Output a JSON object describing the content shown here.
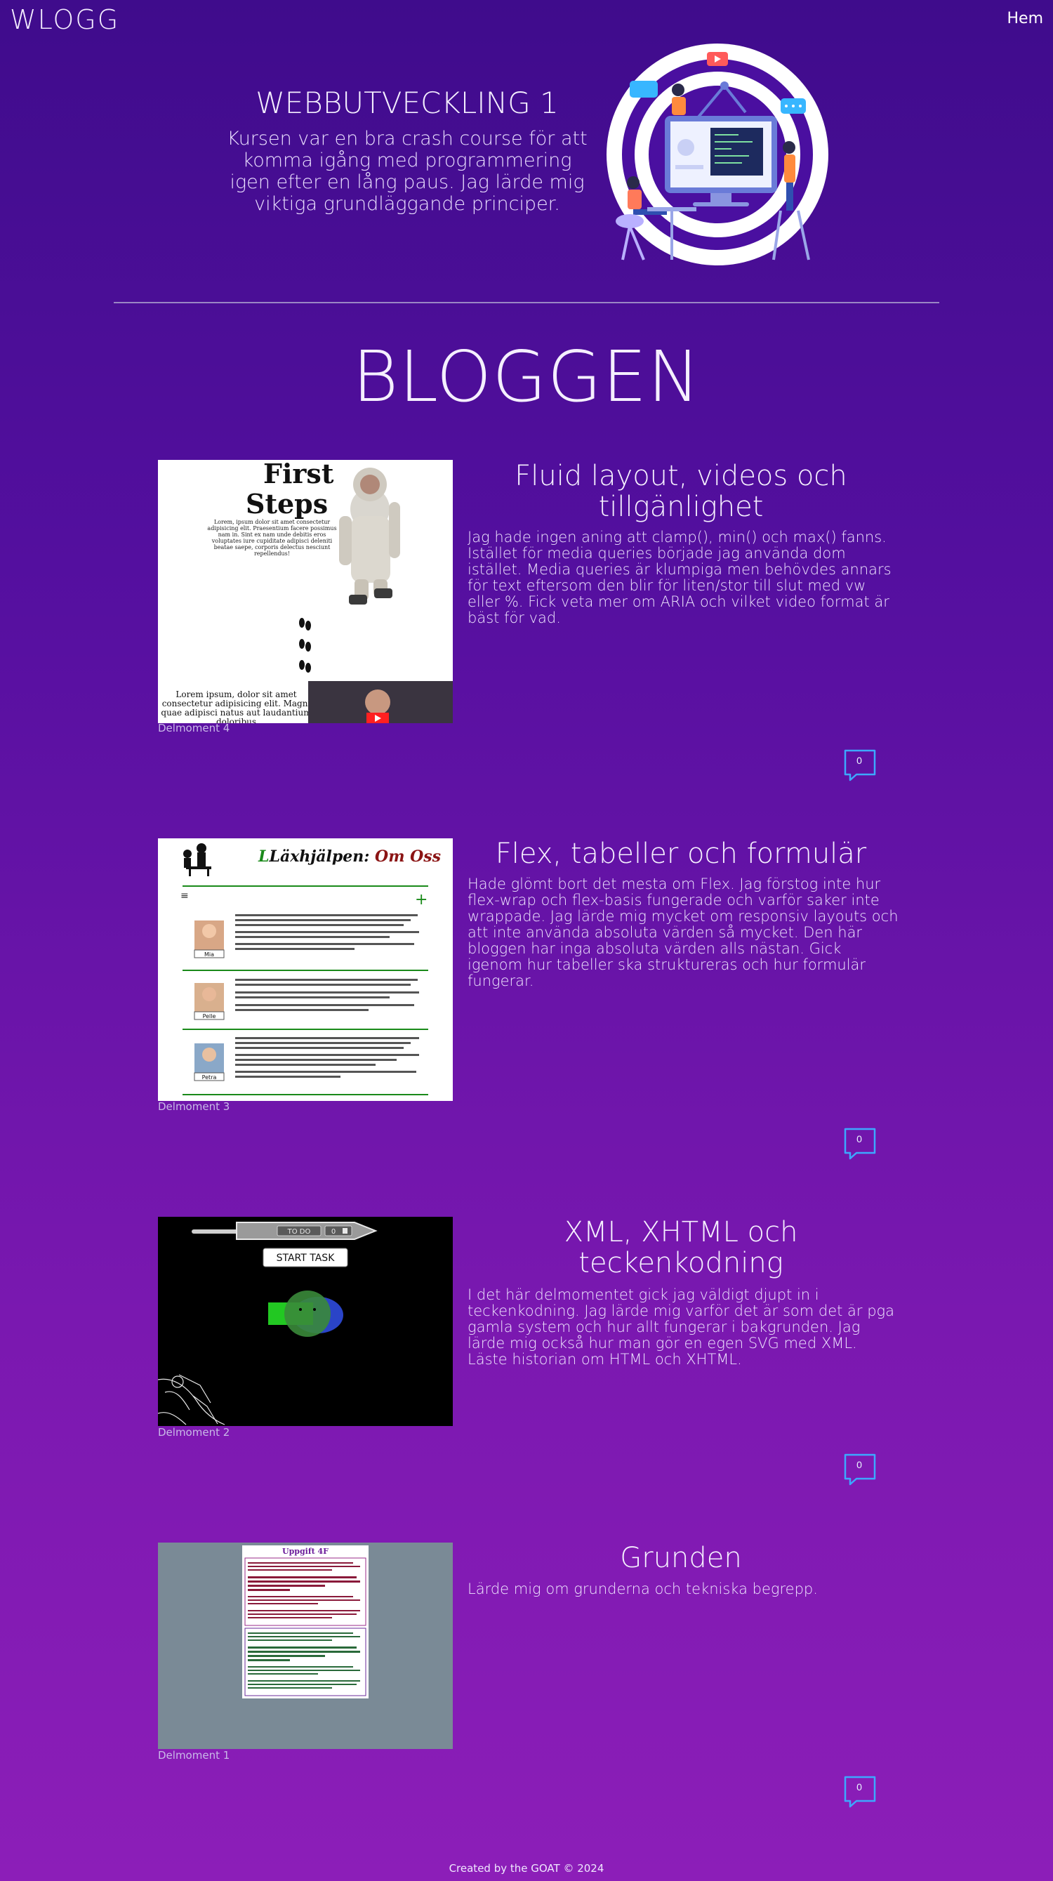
{
  "header": {
    "logo": "WLOGG",
    "nav_home": "Hem"
  },
  "hero": {
    "title": "WEBBUTVECKLING 1",
    "text": "Kursen var en bra crash course för att komma igång med programmering igen efter en lång paus. Jag lärde mig viktiga grundläggande principer."
  },
  "blog": {
    "heading": "BLOGGEN",
    "posts": [
      {
        "title": "Fluid layout, videos och tillgänlighet",
        "text": "Jag hade ingen aning att clamp(), min() och max() fanns. Istället för media queries började jag använda dom istället. Media queries är klumpiga men behövdes annars för text eftersom den blir för liten/stor till slut med vw eller %. Fick veta mer om ARIA och vilket video format är bäst för vad.",
        "caption": "Delmoment 4",
        "comments": "0",
        "thumb": {
          "h1": "First",
          "h2": "Steps",
          "lorem_top": "Lorem, ipsum dolor sit amet consectetur adipisicing elit. Praesentium facere possimus nam in. Sint ex nam unde debitis eros voluptates iure cupiditate adipisci deleniti beatae saepe, corporis delectus nesciunt repellendus!",
          "lorem_bottom": "Lorem ipsum, dolor sit amet consectetur adipisicing elit. Magni quae adipisci natus aut laudantium doloribus"
        }
      },
      {
        "title": "Flex, tabeller och formulär",
        "text": "Hade glömt bort det mesta om Flex. Jag förstog inte hur flex-wrap och flex-basis fungerade och varför saker inte wrappade. Jag lärde mig mycket om responsiv layouts och att inte använda absoluta värden så mycket. Den här bloggen har inga absoluta värden alls nästan. Gick igenom hur tabeller ska struktureras och hur formulär fungerar.",
        "caption": "Delmoment 3",
        "comments": "0",
        "thumb": {
          "title_a": "Läxhjälpen: ",
          "title_b": "Om Oss",
          "names": [
            "Mia",
            "Pelle",
            "Petra"
          ]
        }
      },
      {
        "title": "XML, XHTML och teckenkodning",
        "text": "I det här delmomentet gick jag väldigt djupt in i teckenkodning. Jag lärde mig varför det är som det är pga gamla system och hur allt fungerar i bakgrunden. Jag lärde mig också hur man gör en egen SVG med XML. Läste historian om HTML och XHTML.",
        "caption": "Delmoment 2",
        "comments": "0",
        "thumb": {
          "todo": "TO DO",
          "counter": "0",
          "start": "START TASK"
        }
      },
      {
        "title": "Grunden",
        "text": "Lärde mig om grunderna och tekniska begrepp.",
        "caption": "Delmoment 1",
        "comments": "0",
        "thumb": {
          "title": "Uppgift 4F"
        }
      }
    ]
  },
  "footer": {
    "text": "Created by the GOAT © 2024"
  },
  "colors": {
    "accent": "#3da8ff",
    "bg_top": "#3f0c8c",
    "bg_bottom": "#8c1eb8"
  },
  "icons": {
    "comment": "speech-bubble-icon"
  }
}
